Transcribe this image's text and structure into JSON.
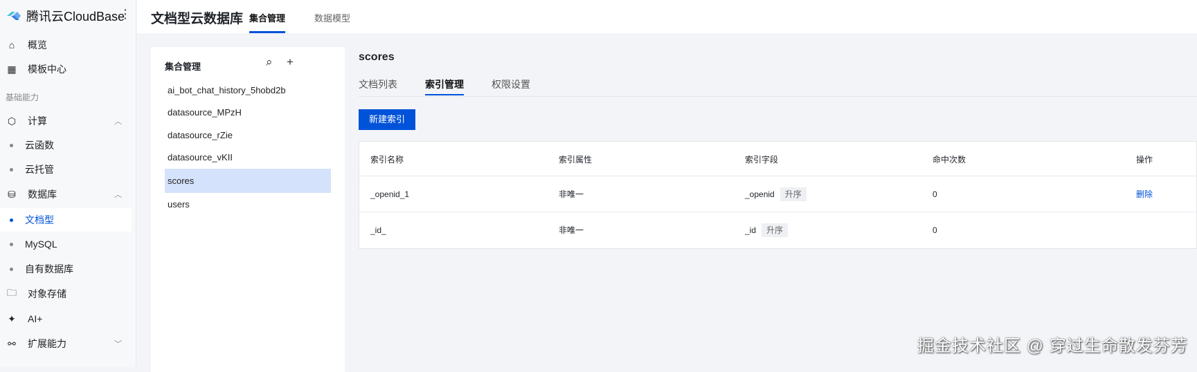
{
  "sidebar": {
    "brand": "腾讯云CloudBase",
    "more": "⋮",
    "items": [
      {
        "label": "概览",
        "icon": "home"
      },
      {
        "label": "模板中心",
        "icon": "grid"
      }
    ],
    "group": "基础能力",
    "compute": {
      "label": "计算",
      "children": [
        "云函数",
        "云托管"
      ]
    },
    "database": {
      "label": "数据库",
      "children": [
        "文档型",
        "MySQL",
        "自有数据库"
      ],
      "active": "文档型"
    },
    "storage": "对象存储",
    "ai": "AI+",
    "ext": "扩展能力"
  },
  "header": {
    "title": "文档型云数据库",
    "tabs": [
      "集合管理",
      "数据模型"
    ]
  },
  "collections": {
    "title": "集合管理",
    "items": [
      "ai_bot_chat_history_5hobd2b",
      "datasource_MPzH",
      "datasource_rZie",
      "datasource_vKII",
      "scores",
      "users"
    ],
    "selected": "scores"
  },
  "main": {
    "title": "scores",
    "tabs": [
      "文档列表",
      "索引管理",
      "权限设置"
    ],
    "new_index": "新建索引",
    "columns": [
      "索引名称",
      "索引属性",
      "索引字段",
      "命中次数",
      "操作"
    ],
    "rows": [
      {
        "name": "_openid_1",
        "attr": "非唯一",
        "field": "_openid",
        "order": "升序",
        "hits": "0",
        "action": "删除"
      },
      {
        "name": "_id_",
        "attr": "非唯一",
        "field": "_id",
        "order": "升序",
        "hits": "0",
        "action": ""
      }
    ]
  },
  "watermark": "掘金技术社区 @ 穿过生命散发芬芳",
  "colors": {
    "accent": "#0052d9",
    "selected": "#d5e2fb"
  }
}
